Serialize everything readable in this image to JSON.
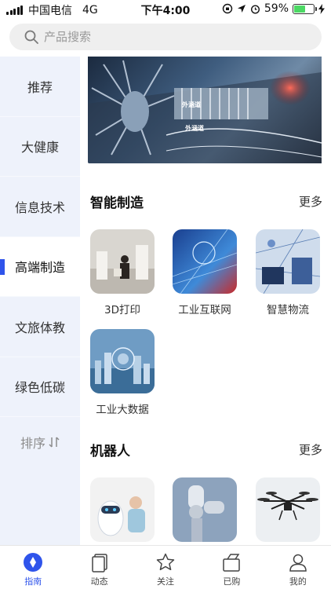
{
  "status_bar": {
    "carrier": "中国电信",
    "network": "4G",
    "time": "下午4:00",
    "battery_percent": "59%",
    "battery_level": 0.59
  },
  "search": {
    "placeholder": "产品搜索"
  },
  "sidebar": {
    "items": [
      {
        "label": "推荐"
      },
      {
        "label": "大健康"
      },
      {
        "label": "信息技术"
      },
      {
        "label": "高端制造"
      },
      {
        "label": "文旅体教"
      },
      {
        "label": "绿色低碳"
      }
    ],
    "active_index": 3,
    "sort_label": "排序"
  },
  "banner": {
    "labels": [
      "外涵道",
      "外涵道"
    ]
  },
  "sections": [
    {
      "title": "智能制造",
      "more": "更多",
      "items": [
        {
          "label": "3D打印"
        },
        {
          "label": "工业互联网"
        },
        {
          "label": "智慧物流"
        },
        {
          "label": "工业大数据"
        }
      ]
    },
    {
      "title": "机器人",
      "more": "更多",
      "items": [
        {
          "label": ""
        },
        {
          "label": ""
        },
        {
          "label": ""
        }
      ]
    }
  ],
  "tabbar": {
    "tabs": [
      {
        "label": "指南",
        "icon": "compass-icon"
      },
      {
        "label": "动态",
        "icon": "cards-icon"
      },
      {
        "label": "关注",
        "icon": "star-icon"
      },
      {
        "label": "已购",
        "icon": "box-icon"
      },
      {
        "label": "我的",
        "icon": "user-icon"
      }
    ],
    "active_index": 0
  },
  "colors": {
    "accent": "#2f54eb",
    "sidebar_bg": "#eef2fb",
    "battery_green": "#4cd964"
  }
}
